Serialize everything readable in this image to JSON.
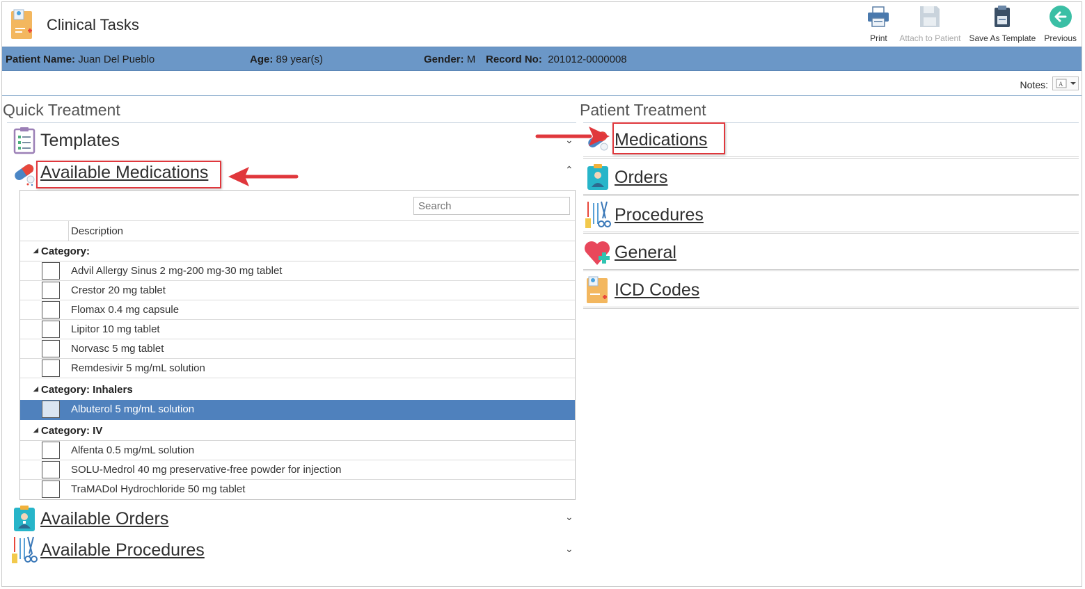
{
  "header": {
    "title": "Clinical Tasks",
    "toolbar": [
      {
        "label": "Print",
        "icon": "printer-icon",
        "enabled": true
      },
      {
        "label": "Attach to Patient",
        "icon": "floppy-disk-icon",
        "enabled": false
      },
      {
        "label": "Save As Template",
        "icon": "clipboard-save-icon",
        "enabled": true
      },
      {
        "label": "Previous",
        "icon": "back-arrow-icon",
        "enabled": true
      }
    ]
  },
  "patient": {
    "name_label": "Patient Name:",
    "name": "Juan Del Pueblo",
    "age_label": "Age:",
    "age": "89 year(s)",
    "gender_label": "Gender:",
    "gender": "M",
    "record_label": "Record No:",
    "record": "201012-0000008"
  },
  "notes": {
    "label": "Notes:"
  },
  "quick_treatment": {
    "title": "Quick Treatment",
    "sections": {
      "templates": "Templates",
      "available_medications": "Available Medications",
      "available_orders": "Available Orders",
      "available_procedures": "Available Procedures"
    },
    "search_placeholder": "Search",
    "column_description": "Description",
    "categories": [
      {
        "label": "Category:",
        "items": [
          "Advil Allergy Sinus 2 mg-200 mg-30 mg tablet",
          "Crestor 20 mg tablet",
          "Flomax 0.4 mg capsule",
          "Lipitor 10 mg tablet",
          "Norvasc 5 mg tablet",
          "Remdesivir 5 mg/mL solution"
        ]
      },
      {
        "label": "Category: Inhalers",
        "items": [
          "Albuterol 5 mg/mL solution"
        ]
      },
      {
        "label": "Category: IV",
        "items": [
          "Alfenta 0.5 mg/mL solution",
          "SOLU-Medrol 40 mg preservative-free powder for injection",
          "TraMADol Hydrochloride 50 mg tablet"
        ]
      }
    ],
    "selected_item": "Albuterol 5 mg/mL solution"
  },
  "patient_treatment": {
    "title": "Patient Treatment",
    "items": [
      "Medications",
      "Orders",
      "Procedures",
      "General",
      "ICD Codes"
    ]
  },
  "colors": {
    "patient_bar": "#6b97c7",
    "selection": "#4f81bd",
    "highlight_box": "#e0373c"
  }
}
